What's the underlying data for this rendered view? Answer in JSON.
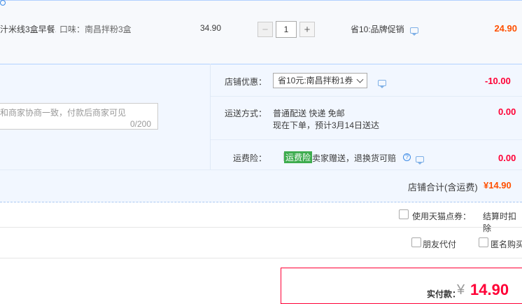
{
  "item": {
    "title": "汁米线3盒早餐...",
    "sku": "口味：南昌拌粉3盒",
    "unit_price": "34.90",
    "quantity": "1",
    "promo": "省10:品牌促销",
    "total": "24.90"
  },
  "order": {
    "message_placeholder": "和商家协商一致，付款后商家可见",
    "message_count": "0/200",
    "store_discount_label": "店铺优惠：",
    "store_discount_value": "省10元:南昌拌粉1券",
    "store_discount_amount": "-10.00",
    "shipping_label": "运送方式：",
    "shipping_method": "普通配送 快递 免邮",
    "shipping_eta": "现在下单，预计3月14日送达",
    "shipping_amount": "0.00",
    "insurance_label": "运费险：",
    "insurance_badge": "运费险",
    "insurance_text": "卖家赠送，退换货可赔",
    "insurance_amount": "0.00",
    "store_total_label": "店铺合计(含运费)",
    "store_total_value": "¥14.90"
  },
  "options": {
    "tmall_points_label": "使用天猫点券：",
    "tmall_points_note": "结算时扣除",
    "friend_pay_label": "朋友代付",
    "anonymous_label": "匿名购买"
  },
  "payment": {
    "label": "实付款：",
    "currency": "¥",
    "amount": "14.90"
  },
  "colors": {
    "accent_blue": "#3d8be6",
    "price_orange": "#ff5000",
    "price_red": "#ff0036",
    "panel_bg": "#f2f7ff",
    "badge_green": "#3eac4e"
  }
}
